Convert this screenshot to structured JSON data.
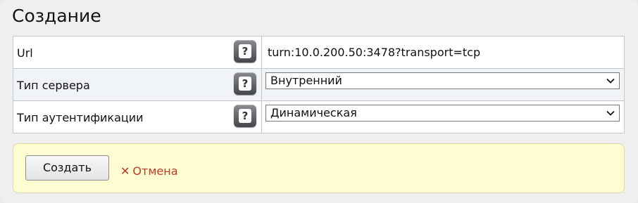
{
  "page": {
    "title": "Создание"
  },
  "form": {
    "rows": [
      {
        "label": "Url",
        "value": "turn:10.0.200.50:3478?transport=tcp",
        "help_icon": "question-icon"
      },
      {
        "label": "Тип сервера",
        "value": "Внутренний",
        "help_icon": "question-icon"
      },
      {
        "label": "Тип аутентификации",
        "value": "Динамическая",
        "help_icon": "question-icon"
      }
    ]
  },
  "actions": {
    "create_label": "Создать",
    "cancel_icon": "✕",
    "cancel_label": "Отмена"
  },
  "colors": {
    "actions_bg": "#fefdd2",
    "cancel_text": "#c0392b",
    "row_alt_bg": "#f1f4f7"
  }
}
